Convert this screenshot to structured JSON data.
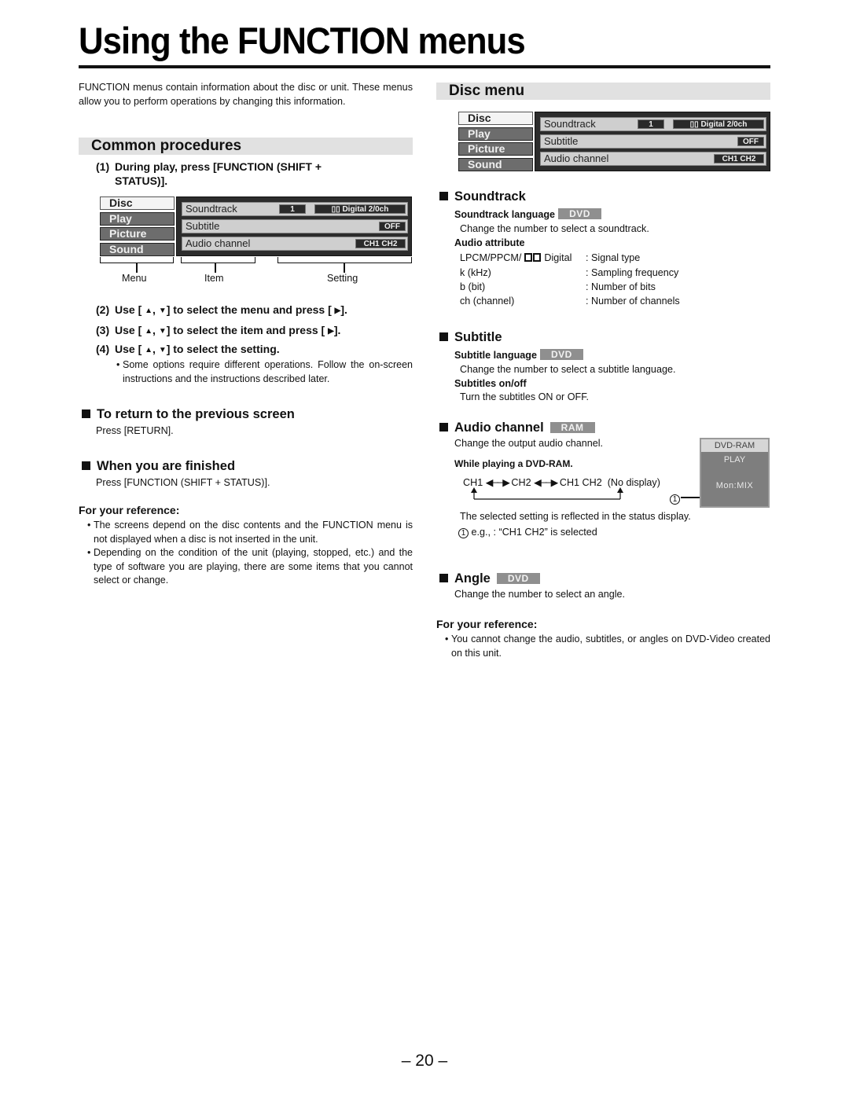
{
  "page": {
    "title": "Using the FUNCTION menus",
    "page_number": "– 20 –"
  },
  "left": {
    "intro": "FUNCTION menus contain information about the disc or unit. These menus allow you to perform operations by changing this information.",
    "common_procedures": {
      "heading": "Common procedures",
      "step1_num": "(1)",
      "step1_line1": "During play, press [FUNCTION (SHIFT +",
      "step1_line2": "STATUS)].",
      "osd": {
        "menus": [
          "Disc",
          "Play",
          "Picture",
          "Sound"
        ],
        "items": [
          "Soundtrack",
          "Subtitle",
          "Audio channel"
        ],
        "soundtrack_number": "1",
        "soundtrack_format": "Digital 2/0ch",
        "subtitle_value": "OFF",
        "audio_channel_value": "CH1 CH2"
      },
      "labels": {
        "menu": "Menu",
        "item": "Item",
        "setting": "Setting"
      },
      "step2": {
        "num": "(2)",
        "pre": "Use [",
        "mid": ",",
        "post": "] to select the menu and press [",
        "end": "]."
      },
      "step3": {
        "num": "(3)",
        "pre": "Use [",
        "mid": ",",
        "post": "] to select the item and press [",
        "end": "]."
      },
      "step4": {
        "num": "(4)",
        "pre": "Use [",
        "mid": ",",
        "post": "] to select the setting."
      },
      "step4_note": "Some options require different operations. Follow the on-screen instructions and the instructions described later."
    },
    "return_section": {
      "heading": "To return to the previous screen",
      "text": "Press [RETURN]."
    },
    "finished_section": {
      "heading": "When you are finished",
      "text": "Press [FUNCTION (SHIFT + STATUS)]."
    },
    "reference": {
      "heading": "For your reference:",
      "bullets": [
        "The screens depend on the disc contents and the FUNCTION menu is not displayed when a disc is not inserted in the unit.",
        "Depending on the condition of the unit (playing, stopped, etc.) and the type of software you are playing, there are some items that you cannot select or change."
      ]
    }
  },
  "right": {
    "disc_menu": {
      "heading": "Disc menu"
    },
    "soundtrack": {
      "heading": "Soundtrack",
      "lang_label": "Soundtrack language",
      "lang_badge": "DVD",
      "lang_text": "Change the number to select a soundtrack.",
      "attr_label": "Audio attribute",
      "attrs": [
        {
          "k_pre": "LPCM/PPCM/",
          "k_post": "Digital",
          "v": ": Signal type"
        },
        {
          "k": "k (kHz)",
          "v": ": Sampling frequency"
        },
        {
          "k": "b (bit)",
          "v": ": Number of bits"
        },
        {
          "k": "ch (channel)",
          "v": ": Number of channels"
        }
      ]
    },
    "subtitle": {
      "heading": "Subtitle",
      "lang_label": "Subtitle language",
      "lang_badge": "DVD",
      "lang_text": "Change the number to select a subtitle language.",
      "onoff_label": "Subtitles on/off",
      "onoff_text": "Turn the subtitles ON or OFF."
    },
    "audio_channel": {
      "heading": "Audio channel",
      "badge": "RAM",
      "text": "Change the output audio channel.",
      "while_label": "While playing a DVD-RAM.",
      "cycle": [
        "CH1",
        "CH2",
        "CH1 CH2"
      ],
      "no_display": "(No display)",
      "callout": "1",
      "status_box": {
        "line1": "DVD-RAM",
        "line2": "PLAY",
        "line3": "Mon:MIX"
      },
      "reflect_text": "The selected setting is reflected in the status display.",
      "example_text": "e.g., : “CH1 CH2” is selected"
    },
    "angle": {
      "heading": "Angle",
      "badge": "DVD",
      "text": "Change the number to select an angle."
    },
    "reference": {
      "heading": "For your reference:",
      "bullets": [
        "You cannot change the audio, subtitles, or angles on DVD-Video created on this unit."
      ]
    }
  }
}
